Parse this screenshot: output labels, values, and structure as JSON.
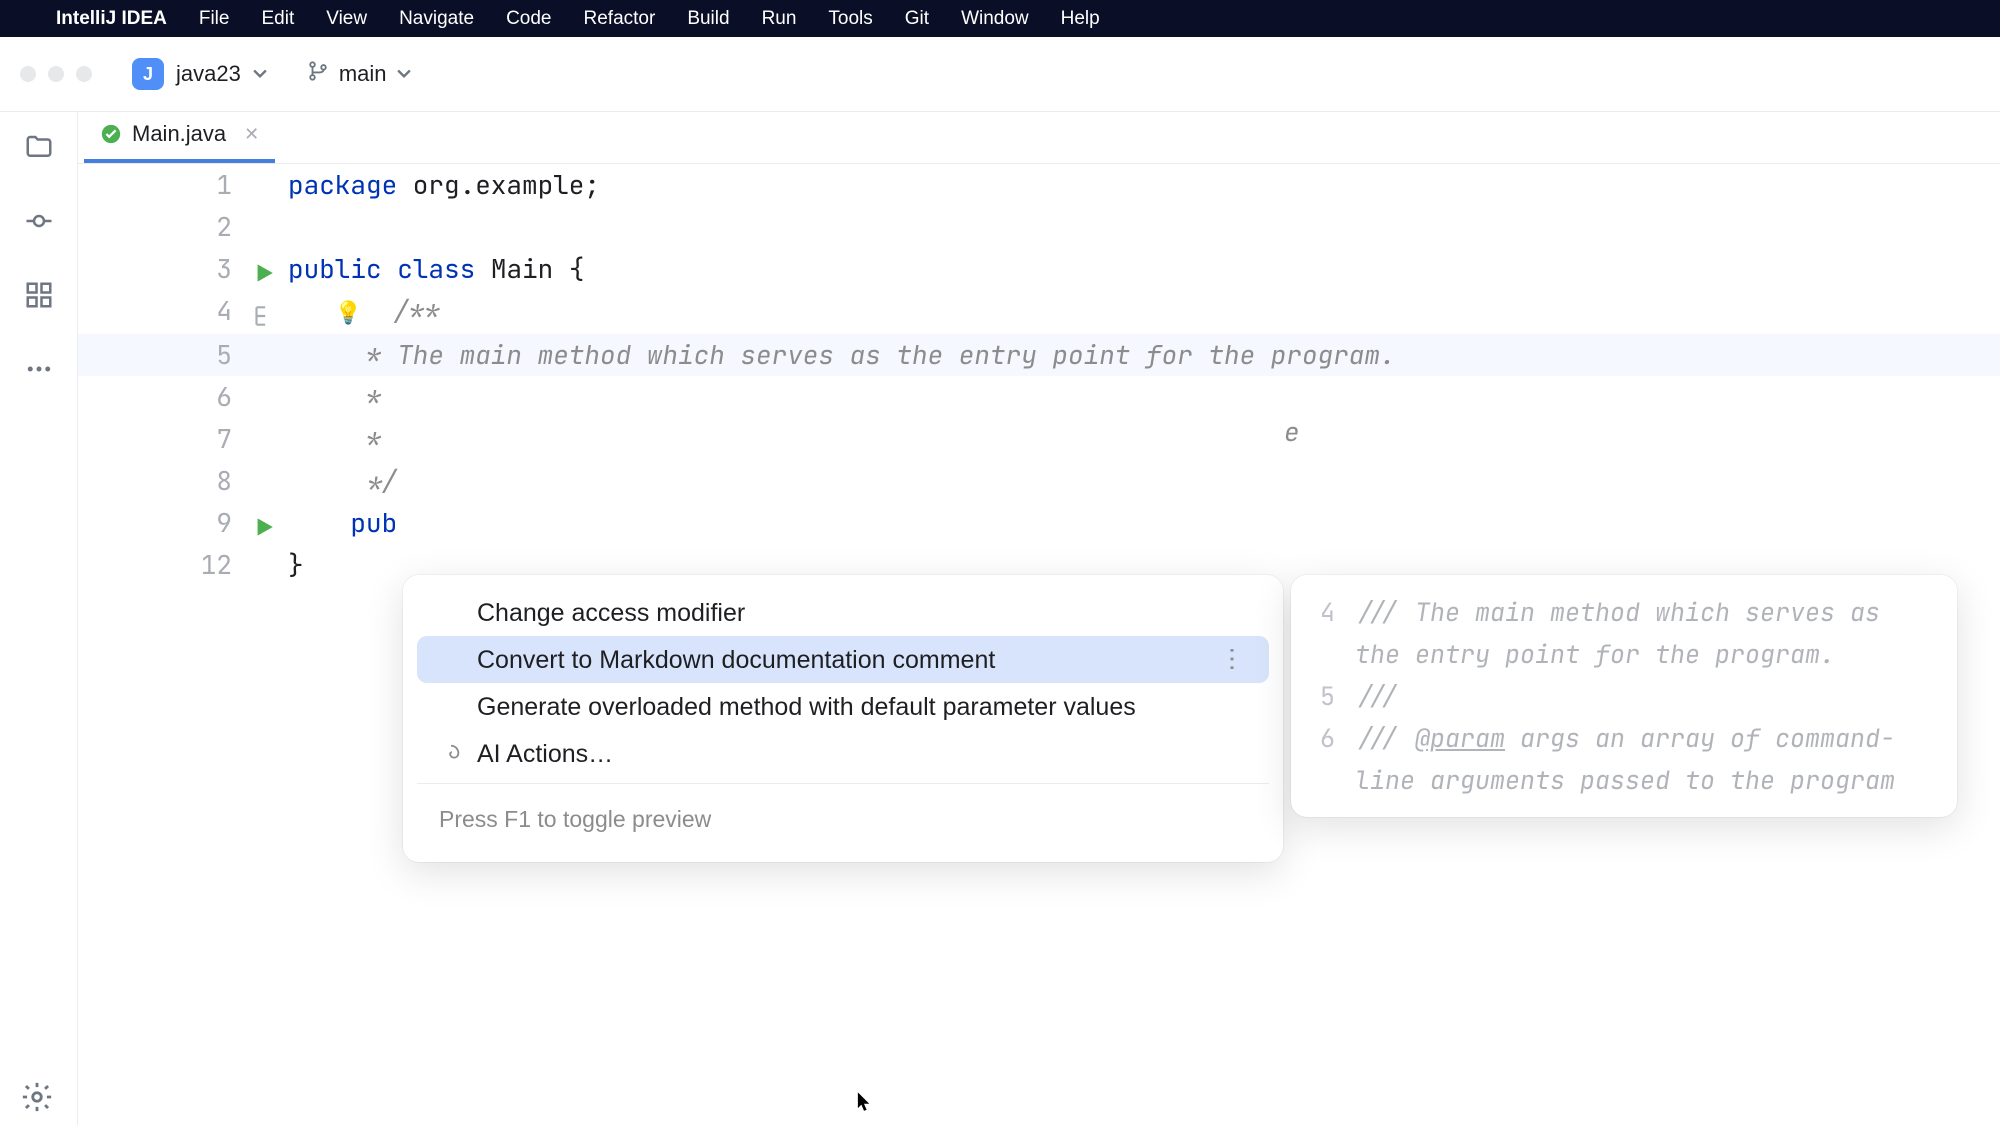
{
  "menubar": {
    "app": "IntelliJ IDEA",
    "items": [
      "File",
      "Edit",
      "View",
      "Navigate",
      "Code",
      "Refactor",
      "Build",
      "Run",
      "Tools",
      "Git",
      "Window",
      "Help"
    ]
  },
  "toolbar": {
    "project_initial": "J",
    "project_name": "java23",
    "branch": "main"
  },
  "tab": {
    "filename": "Main.java"
  },
  "code": {
    "l1": {
      "n": "1",
      "kw": "package",
      "rest": " org.example;"
    },
    "l2": {
      "n": "2"
    },
    "l3": {
      "n": "3",
      "a": "public",
      "b": "class",
      "c": "Main {"
    },
    "l4": {
      "n": "4",
      "t": "/**"
    },
    "l5": {
      "n": "5",
      "t": " * The main method which serves as the entry point for the program."
    },
    "l6": {
      "n": "6",
      "t": " *"
    },
    "l7": {
      "n": "7",
      "t": " *"
    },
    "l8": {
      "n": "8",
      "t": " */"
    },
    "l9": {
      "n": "9",
      "t": "pub"
    },
    "l12": {
      "n": "12",
      "t": "}"
    }
  },
  "popup": {
    "items": [
      "Change access modifier",
      "Convert to Markdown documentation comment",
      "Generate overloaded method with default parameter values",
      "AI Actions…"
    ],
    "footer": "Press F1 to toggle preview"
  },
  "preview": {
    "rows": [
      {
        "n": "4",
        "t": "/// The main method which serves as the entry point for the program."
      },
      {
        "n": "5",
        "t": "///"
      },
      {
        "n": "6",
        "param": "@param",
        "t_before": "/// ",
        "t_after": " args an array of command-line arguments passed to the program"
      }
    ]
  },
  "bg_hint": "e"
}
